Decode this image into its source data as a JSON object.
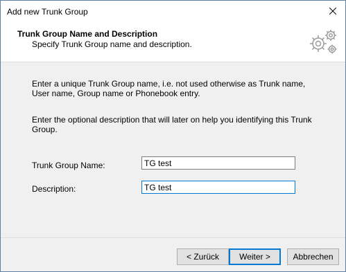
{
  "window": {
    "title": "Add new Trunk Group",
    "close_icon": "close-icon"
  },
  "header": {
    "title": "Trunk Group Name and Description",
    "subtitle": "Specify Trunk Group name and description.",
    "icon": "gears-icon"
  },
  "content": {
    "instruction_name": "Enter a unique Trunk Group name, i.e. not used otherwise as Trunk name, User name, Group name or Phonebook entry.",
    "instruction_description": "Enter the optional description that will later on help you identifying this Trunk Group.",
    "fields": {
      "name_label": "Trunk Group Name:",
      "name_value": "TG test",
      "description_label": "Description:",
      "description_value": "TG test"
    }
  },
  "buttons": {
    "back": "< Zurück",
    "next": "Weiter >",
    "cancel": "Abbrechen"
  },
  "colors": {
    "focus_border": "#0078d7",
    "dialog_background": "#f0f0f0",
    "header_background": "#ffffff"
  }
}
